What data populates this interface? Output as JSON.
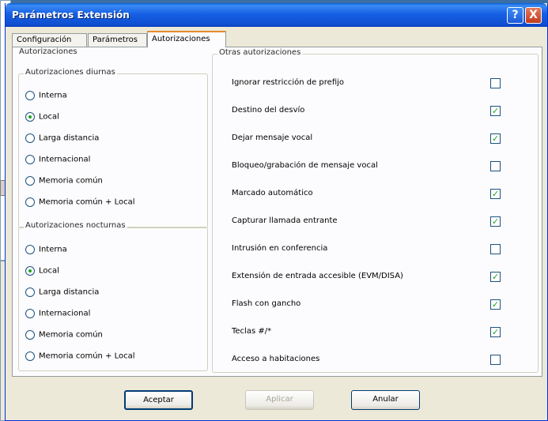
{
  "window": {
    "title": "Parámetros Extensión",
    "help_label": "?",
    "close_label": "X"
  },
  "tabs": [
    {
      "label": "Configuración"
    },
    {
      "label": "Parámetros"
    },
    {
      "label": "Autorizaciones",
      "active": true
    }
  ],
  "authorizations": {
    "group_label": "Autorizaciones",
    "day": {
      "label": "Autorizaciones diurnas",
      "options": [
        {
          "label": "Interna",
          "selected": false
        },
        {
          "label": "Local",
          "selected": true
        },
        {
          "label": "Larga distancia",
          "selected": false
        },
        {
          "label": "Internacional",
          "selected": false
        },
        {
          "label": "Memoria común",
          "selected": false
        },
        {
          "label": "Memoria común + Local",
          "selected": false
        }
      ]
    },
    "night": {
      "label": "Autorizaciones nocturnas",
      "options": [
        {
          "label": "Interna",
          "selected": false
        },
        {
          "label": "Local",
          "selected": true
        },
        {
          "label": "Larga distancia",
          "selected": false
        },
        {
          "label": "Internacional",
          "selected": false
        },
        {
          "label": "Memoria común",
          "selected": false
        },
        {
          "label": "Memoria común + Local",
          "selected": false
        }
      ]
    }
  },
  "other": {
    "label": "Otras autorizaciones",
    "items": [
      {
        "label": "Ignorar restricción de prefijo",
        "checked": false
      },
      {
        "label": "Destino del desvío",
        "checked": true
      },
      {
        "label": "Dejar mensaje vocal",
        "checked": true
      },
      {
        "label": "Bloqueo/grabación de mensaje vocal",
        "checked": false
      },
      {
        "label": "Marcado automático",
        "checked": true
      },
      {
        "label": "Capturar llamada entrante",
        "checked": true
      },
      {
        "label": "Intrusión en conferencia",
        "checked": false
      },
      {
        "label": "Extensión de entrada accesible (EVM/DISA)",
        "checked": true
      },
      {
        "label": "Flash con gancho",
        "checked": true
      },
      {
        "label": "Teclas #/*",
        "checked": true
      },
      {
        "label": "Acceso a habitaciones",
        "checked": false
      }
    ]
  },
  "buttons": {
    "ok": "Aceptar",
    "apply": "Aplicar",
    "cancel": "Anular"
  }
}
